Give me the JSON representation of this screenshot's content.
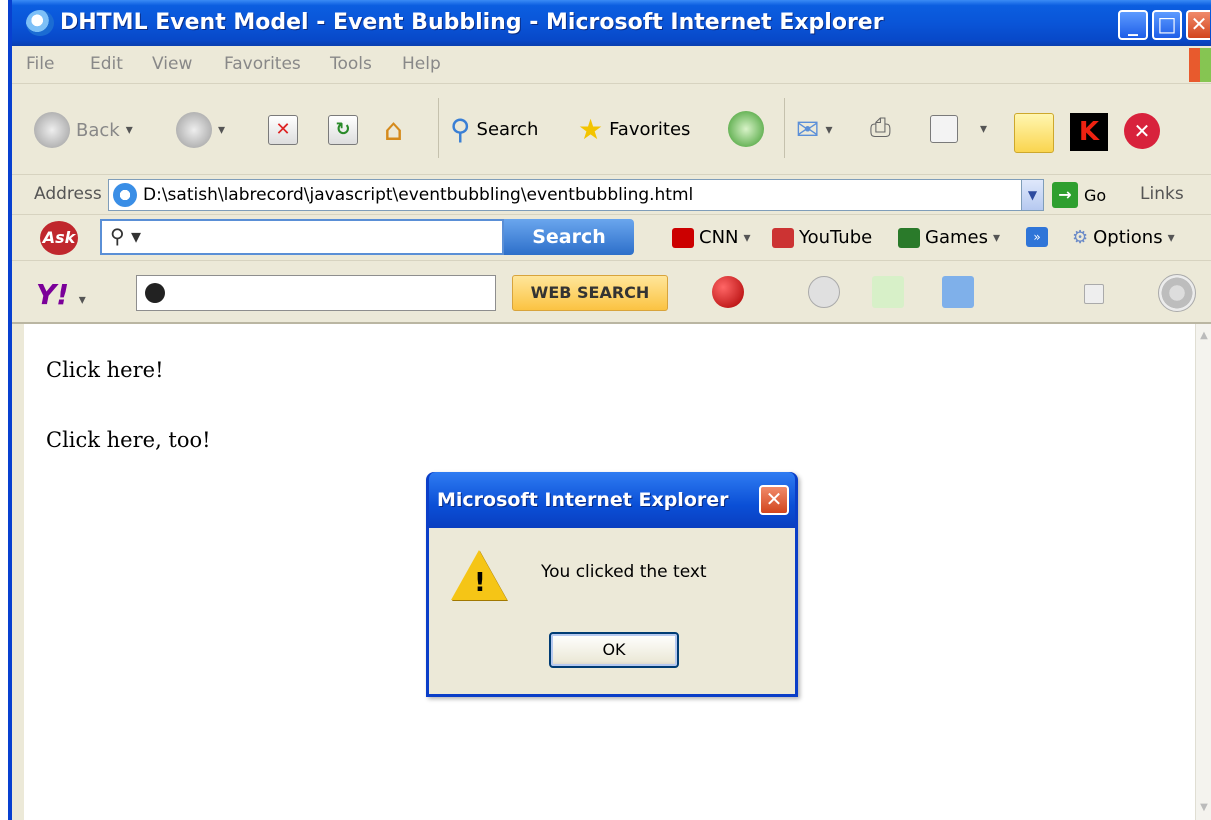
{
  "window": {
    "title": "DHTML Event Model - Event Bubbling - Microsoft Internet Explorer"
  },
  "menu": [
    "File",
    "Edit",
    "View",
    "Favorites",
    "Tools",
    "Help"
  ],
  "toolbar": {
    "back_label": "Back",
    "search_label": "Search",
    "favorites_label": "Favorites"
  },
  "address": {
    "label": "Address",
    "url": "D:\\satish\\labrecord\\javascript\\eventbubbling\\eventbubbling.html",
    "go_label": "Go",
    "links_label": "Links"
  },
  "ask_toolbar": {
    "logo": "Ask",
    "search_button": "Search",
    "cnn": "CNN",
    "youtube": "YouTube",
    "games": "Games",
    "options": "Options"
  },
  "yahoo_toolbar": {
    "logo": "Y!",
    "search_button": "WEB SEARCH"
  },
  "content": {
    "para1": "Click here!",
    "para2": "Click here, too!"
  },
  "dialog": {
    "title": "Microsoft Internet Explorer",
    "message": "You clicked the text",
    "ok_label": "OK"
  },
  "colors": {
    "titlebar": "#0a55d8",
    "dialog_frame": "#0a3ec8",
    "chrome": "#ece9d8"
  }
}
